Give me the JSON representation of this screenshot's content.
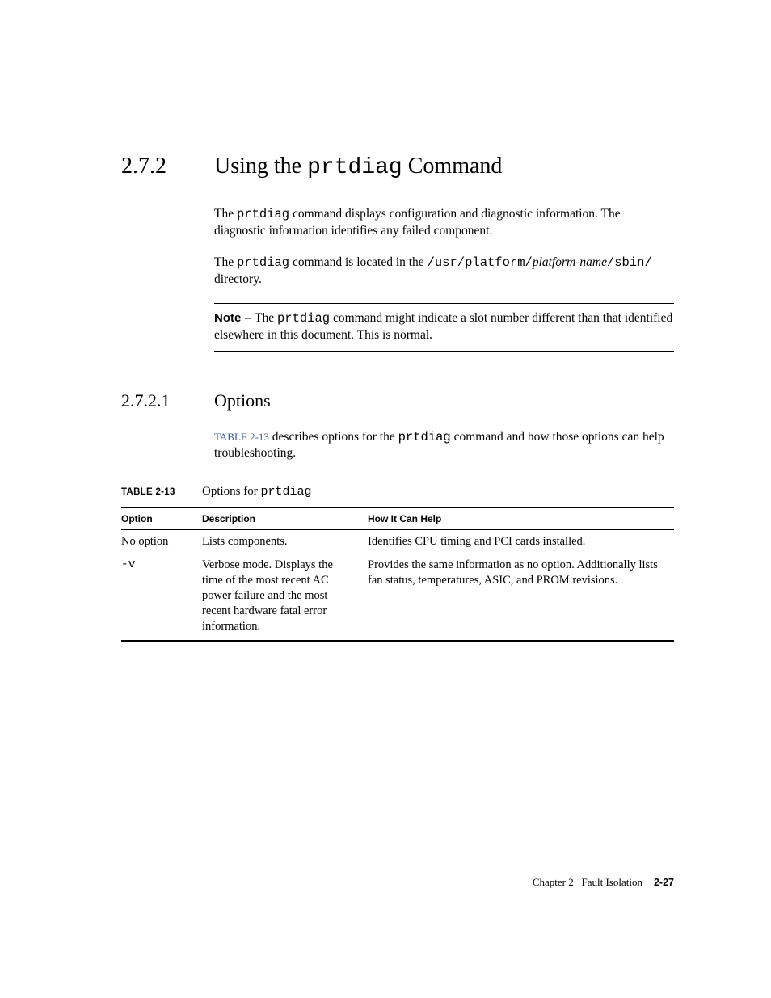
{
  "section": {
    "number": "2.7.2",
    "title_pre": "Using the ",
    "title_cmd": "prtdiag",
    "title_post": " Command"
  },
  "para1": {
    "pre": "The ",
    "cmd": "prtdiag",
    "post": " command displays configuration and diagnostic information. The diagnostic information identifies any failed component."
  },
  "para2": {
    "pre": "The ",
    "cmd": "prtdiag",
    "mid": " command is located in the ",
    "path1": "/usr/platform/",
    "path_italic": "platform-name",
    "path2": "/sbin/",
    "post": " directory."
  },
  "note": {
    "label": "Note – ",
    "pre": "The ",
    "cmd": "prtdiag",
    "post": " command might indicate a slot number different than that identified elsewhere in this document. This is normal."
  },
  "subsection": {
    "number": "2.7.2.1",
    "title": "Options"
  },
  "intro": {
    "ref": "TABLE 2-13",
    "mid": " describes options for the ",
    "cmd": "prtdiag",
    "post": " command and how those options can help troubleshooting."
  },
  "table": {
    "caption_label": "TABLE 2-13",
    "caption_pre": "Options for ",
    "caption_cmd": "prtdiag",
    "headers": {
      "option": "Option",
      "description": "Description",
      "help": "How It Can Help"
    },
    "rows": [
      {
        "option": "No option",
        "description": "Lists components.",
        "help": "Identifies CPU timing and PCI cards installed."
      },
      {
        "option": "-v",
        "description": "Verbose mode. Displays the time of the most recent AC power failure and the most recent hardware fatal error information.",
        "help": "Provides the same information as no option. Additionally lists fan status, temperatures, ASIC, and PROM revisions."
      }
    ]
  },
  "footer": {
    "chapter": "Chapter 2",
    "title": "Fault Isolation",
    "page": "2-27"
  }
}
